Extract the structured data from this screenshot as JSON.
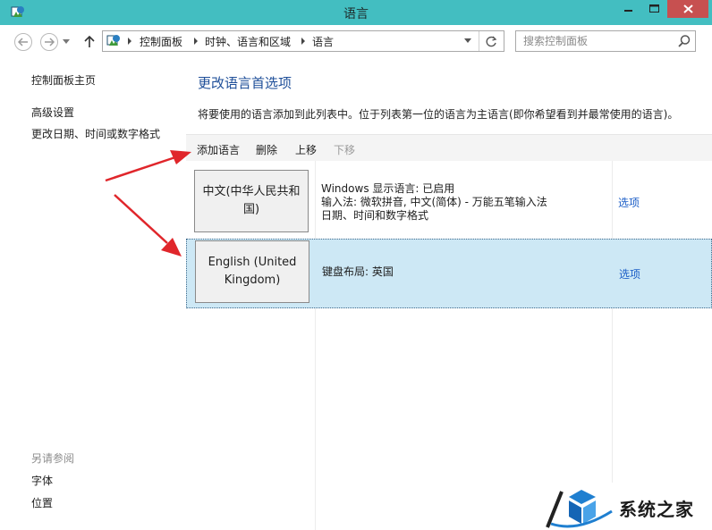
{
  "window": {
    "title": "语言",
    "icons": {
      "app": "control-panel-icon",
      "minimize": "minimize-icon",
      "maximize": "maximize-icon",
      "close": "close-icon"
    },
    "colors": {
      "titlebar": "#43bec1",
      "close": "#c75050"
    }
  },
  "address_bar": {
    "breadcrumb": [
      "控制面板",
      "时钟、语言和区域",
      "语言"
    ],
    "icons": {
      "back": "back-arrow-icon",
      "forward": "forward-arrow-icon",
      "up": "up-arrow-icon",
      "refresh": "refresh-icon",
      "dropdown": "chevron-down-icon"
    }
  },
  "search": {
    "placeholder": "搜索控制面板",
    "value": "",
    "icon": "search-icon"
  },
  "sidebar": {
    "items": [
      "控制面板主页",
      "高级设置",
      "更改日期、时间或数字格式"
    ],
    "see_also": {
      "heading": "另请参阅",
      "items": [
        "字体",
        "位置"
      ]
    }
  },
  "main": {
    "title": "更改语言首选项",
    "description": "将要使用的语言添加到此列表中。位于列表第一位的语言为主语言(即你希望看到并最常使用的语言)。",
    "toolbar": {
      "add": "添加语言",
      "remove": "删除",
      "move_up": "上移",
      "move_down": "下移"
    },
    "languages": [
      {
        "name": "中文(中华人民共和国)",
        "details": [
          "Windows 显示语言: 已启用",
          "输入法: 微软拼音, 中文(简体) - 万能五笔输入法",
          "日期、时间和数字格式"
        ],
        "options": "选项",
        "selected": false
      },
      {
        "name": "English (United Kingdom)",
        "details": [
          "键盘布局: 英国"
        ],
        "options": "选项",
        "selected": true
      }
    ],
    "colors": {
      "title": "#1f4f99",
      "link": "#1c5ec7",
      "selected_row": "#cde8f5",
      "arrow": "#e0262b"
    }
  },
  "watermark": {
    "text": "系统之家"
  }
}
